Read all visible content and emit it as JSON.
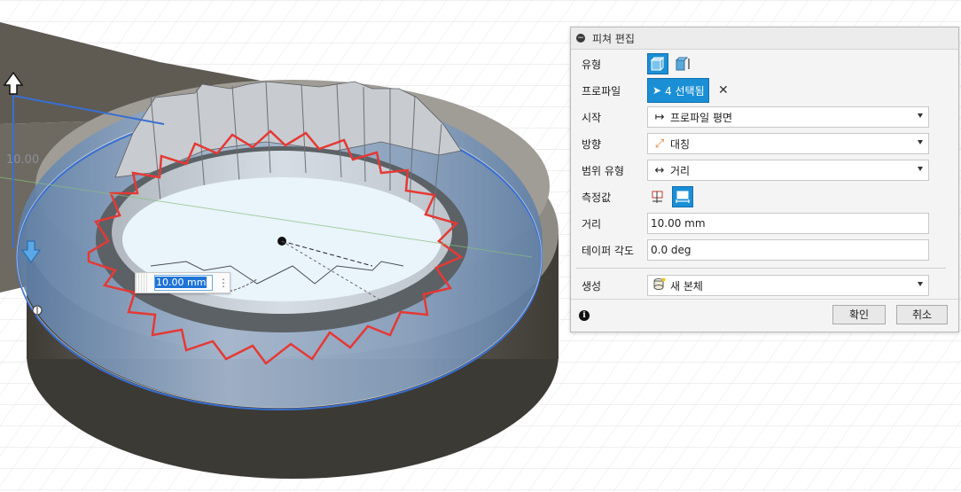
{
  "viewport": {
    "dimension_label": "10.00",
    "distance_input_value": "10.00 mm"
  },
  "panel": {
    "title": "피쳐 편집",
    "rows": {
      "type_label": "유형",
      "profile_label": "프로파일",
      "profile_selection": "4 선택됨",
      "start_label": "시작",
      "start_value": "프로파일 평면",
      "direction_label": "방향",
      "direction_value": "대칭",
      "extent_label": "범위 유형",
      "extent_value": "거리",
      "measure_label": "측정값",
      "distance_label": "거리",
      "distance_value": "10.00 mm",
      "taper_label": "테이퍼 각도",
      "taper_value": "0.0 deg",
      "operation_label": "생성",
      "operation_value": "새 본체"
    },
    "buttons": {
      "ok": "확인",
      "cancel": "취소"
    }
  },
  "colors": {
    "accent": "#1a8fd6",
    "body_dark": "#5e5a52",
    "selection_blue": "#3a6fd1",
    "profile_red": "#e53935"
  }
}
